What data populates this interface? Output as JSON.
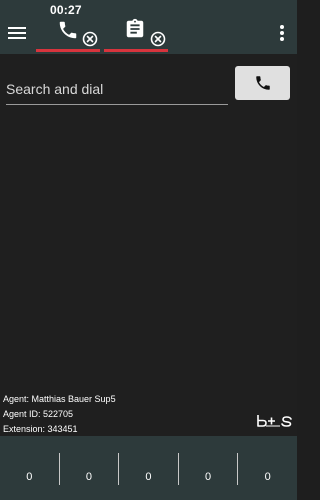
{
  "header": {
    "call_tab": {
      "timer": "00:27",
      "icon": "phone-icon",
      "close_icon": "close-circle-icon"
    },
    "notes_tab": {
      "icon": "clipboard-icon",
      "close_icon": "close-circle-icon"
    },
    "menu_icon": "hamburger-icon",
    "more_icon": "more-vertical-icon",
    "active_tab_color": "#d7343d"
  },
  "search": {
    "placeholder": "Search and dial",
    "value": ""
  },
  "dial_button": {
    "icon": "phone-icon"
  },
  "agent": {
    "name_line": "Agent: Matthias Bauer Sup5",
    "id_line": "Agent ID: 522705",
    "extension_line": "Extension: 343451"
  },
  "logo_text": "b+s",
  "stats": [
    "0",
    "0",
    "0",
    "0",
    "0"
  ],
  "colors": {
    "header_bg": "#2d3a3b",
    "body_bg": "#1f1f1f",
    "accent_red": "#d7343d"
  }
}
